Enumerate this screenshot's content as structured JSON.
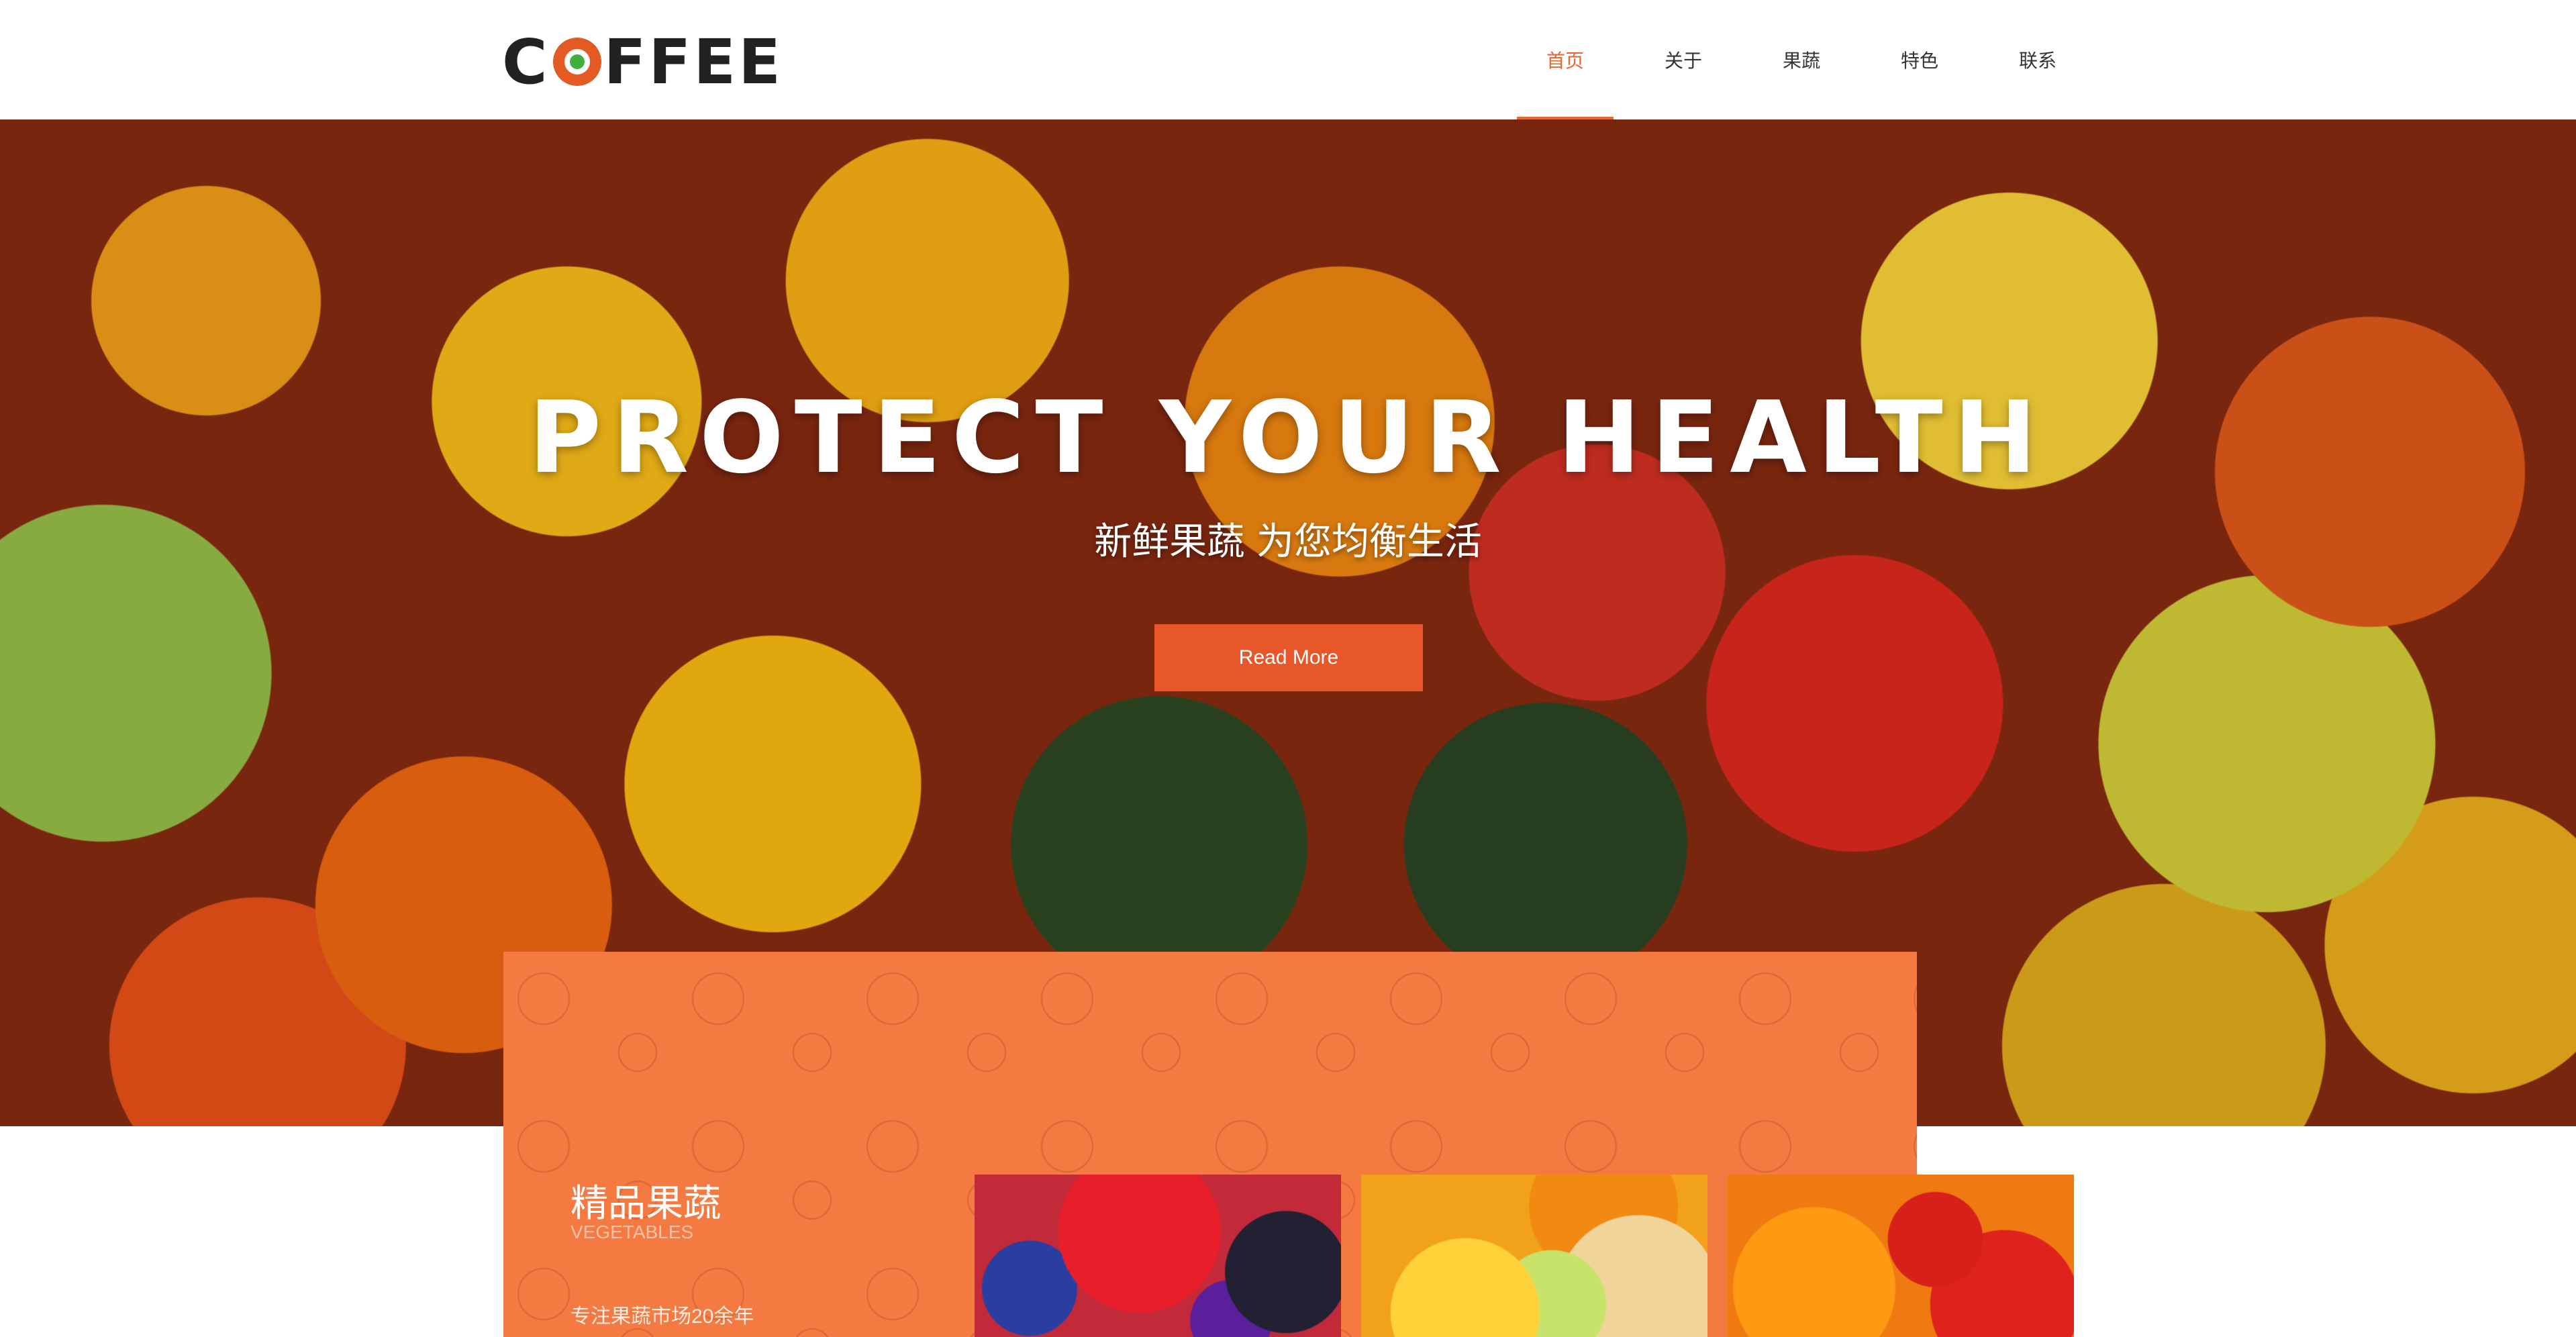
{
  "header": {
    "logo_text": "COFFEE",
    "nav": [
      {
        "label": "首页",
        "active": true
      },
      {
        "label": "关于",
        "active": false
      },
      {
        "label": "果蔬",
        "active": false
      },
      {
        "label": "特色",
        "active": false
      },
      {
        "label": "联系",
        "active": false
      }
    ]
  },
  "hero": {
    "title": "PROTECT YOUR HEALTH",
    "subtitle": "新鲜果蔬 为您均衡生活",
    "button_label": "Read More"
  },
  "feature": {
    "heading": "精品果蔬",
    "subheading": "VEGETABLES",
    "description": "专注果蔬市场20余年"
  },
  "colors": {
    "accent": "#e8662c",
    "panel": "#f47a41",
    "button": "#e8572a",
    "text_dark": "#333333"
  }
}
